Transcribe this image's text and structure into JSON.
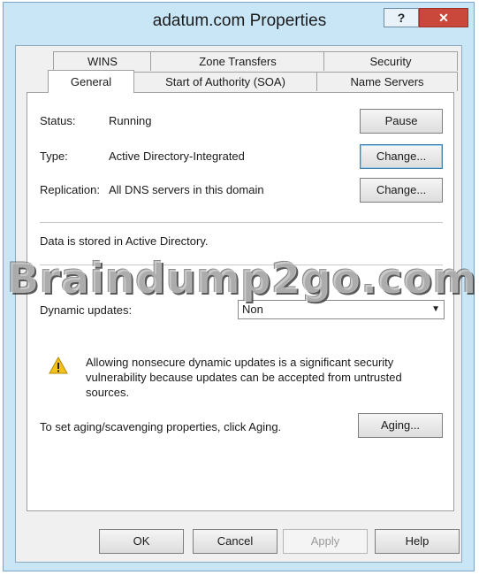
{
  "window": {
    "title": "adatum.com Properties",
    "help_label": "?",
    "close_label": "✕"
  },
  "tabs": {
    "row1": [
      "WINS",
      "Zone Transfers",
      "Security"
    ],
    "row2": [
      "General",
      "Start of Authority (SOA)",
      "Name Servers"
    ],
    "active": "General"
  },
  "general": {
    "status_label": "Status:",
    "status_value": "Running",
    "pause_label": "Pause",
    "type_label": "Type:",
    "type_value": "Active Directory-Integrated",
    "change_type_label": "Change...",
    "replication_label": "Replication:",
    "replication_value": "All DNS servers in this domain",
    "change_replication_label": "Change...",
    "storage_text": "Data is stored in Active Directory.",
    "dynamic_updates_label": "Dynamic updates:",
    "dynamic_updates_value": "Non",
    "warning_text": "Allowing nonsecure dynamic updates is a significant security vulnerability because updates can be accepted from untrusted sources.",
    "aging_text": "To set aging/scavenging properties, click Aging.",
    "aging_label": "Aging..."
  },
  "footer": {
    "ok_label": "OK",
    "cancel_label": "Cancel",
    "apply_label": "Apply",
    "help_label": "Help"
  },
  "watermark": "Braindump2go.com",
  "colors": {
    "frame": "#c9e6f7",
    "close": "#c9483b",
    "warning": "#f2c21b"
  }
}
